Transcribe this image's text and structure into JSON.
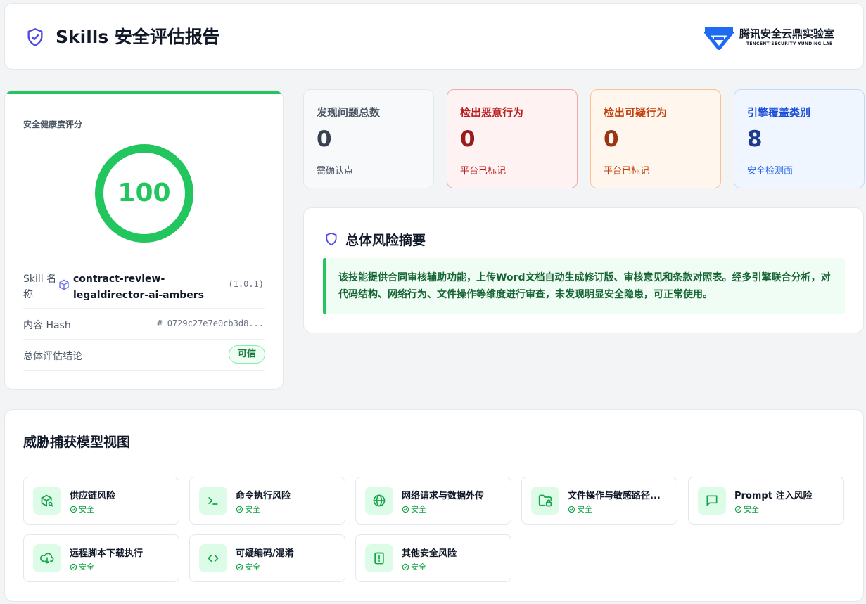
{
  "header": {
    "title": "Skills 安全评估报告",
    "logo_name": "腾讯安全云鼎实验室",
    "logo_sub": "TENCENT SECURITY YUNDING LAB"
  },
  "score_card": {
    "label": "安全健康度评分",
    "score": "100",
    "skill_label": "Skill 名称",
    "skill_name": "contract-review-legaldirector-ai-ambers",
    "version": "(1.0.1)",
    "hash_label": "内容 Hash",
    "hash_value": "# 0729c27e7e0cb3d8...",
    "verdict_label": "总体评估结论",
    "verdict": "可信",
    "accent_color": "#22c55e"
  },
  "stats": [
    {
      "title": "发现问题总数",
      "value": "0",
      "sub": "需确认点"
    },
    {
      "title": "检出恶意行为",
      "value": "0",
      "sub": "平台已标记"
    },
    {
      "title": "检出可疑行为",
      "value": "0",
      "sub": "平台已标记"
    },
    {
      "title": "引擎覆盖类别",
      "value": "8",
      "sub": "安全检测面"
    }
  ],
  "summary": {
    "heading": "总体风险摘要",
    "text": "该技能提供合同审核辅助功能，上传Word文档自动生成修订版、审核意见和条款对照表。经多引擎联合分析，对代码结构、网络行为、文件操作等维度进行审查，未发现明显安全隐患，可正常使用。"
  },
  "threat_model": {
    "heading": "威胁捕获模型视图",
    "items": [
      {
        "name": "供应链风险",
        "status": "安全",
        "icon": "package-search-icon"
      },
      {
        "name": "命令执行风险",
        "status": "安全",
        "icon": "terminal-icon"
      },
      {
        "name": "网络请求与数据外传",
        "status": "安全",
        "icon": "globe-icon"
      },
      {
        "name": "文件操作与敏感路径...",
        "status": "安全",
        "icon": "folder-lock-icon"
      },
      {
        "name": "Prompt 注入风险",
        "status": "安全",
        "icon": "message-square-icon"
      },
      {
        "name": "远程脚本下载执行",
        "status": "安全",
        "icon": "cloud-download-icon"
      },
      {
        "name": "可疑编码/混淆",
        "status": "安全",
        "icon": "code-icon"
      },
      {
        "name": "其他安全风险",
        "status": "安全",
        "icon": "file-warning-icon"
      }
    ]
  }
}
